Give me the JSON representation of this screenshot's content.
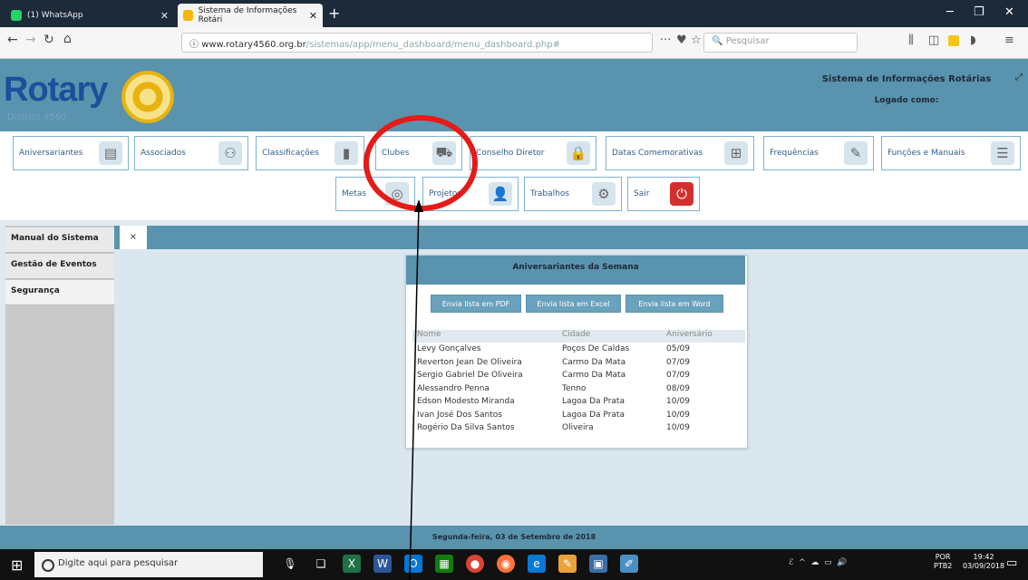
{
  "browser": {
    "tabs": [
      {
        "label": "(1) WhatsApp"
      },
      {
        "label": "Sistema de Informações Rotári"
      }
    ],
    "url": "www.rotary4560.org.br",
    "url_path": "/sistemas/app/menu_dashboard/menu_dashboard.php#",
    "search_placeholder": "Pesquisar"
  },
  "header": {
    "logo_text": "Rotary",
    "logo_sub": "Distrito 4560",
    "site_title": "Sistema de Informações Rotárias",
    "logged_as": "Logado como:"
  },
  "menu": {
    "row1": [
      {
        "label": "Aniversariantes",
        "icon": "calendar-icon"
      },
      {
        "label": "Associados",
        "icon": "people-icon"
      },
      {
        "label": "Classificações",
        "icon": "book-icon"
      },
      {
        "label": "Clubes",
        "icon": "cart-icon"
      },
      {
        "label": "Conselho Diretor",
        "icon": "lock-icon"
      },
      {
        "label": "Datas Comemorativas",
        "icon": "calendar-add-icon"
      },
      {
        "label": "Frequências",
        "icon": "tools-icon"
      },
      {
        "label": "Funções e Manuais",
        "icon": "document-icon"
      }
    ],
    "row2": [
      {
        "label": "Metas",
        "icon": "target-icon"
      },
      {
        "label": "Projetos",
        "icon": "user-icon"
      },
      {
        "label": "Trabalhos",
        "icon": "gear-icon"
      },
      {
        "label": "Sair",
        "icon": "exit-icon"
      }
    ]
  },
  "sidebar": {
    "items": [
      {
        "label": "Manual do Sistema"
      },
      {
        "label": "Gestão de Eventos"
      },
      {
        "label": "Segurança"
      }
    ]
  },
  "content_tab": {
    "close": "×"
  },
  "birthdays": {
    "title": "Aniversariantes da Semana",
    "buttons": [
      "Envia lista em PDF",
      "Envia lista em Excel",
      "Envia lista em Word"
    ],
    "columns": [
      "Nome",
      "Cidade",
      "Aniversário"
    ],
    "rows": [
      [
        "Levy Gonçalves",
        "Poços De Caldas",
        "05/09"
      ],
      [
        "Reverton Jean De Oliveira",
        "Carmo Da Mata",
        "07/09"
      ],
      [
        "Sergio Gabriel De Oliveira",
        "Carmo Da Mata",
        "07/09"
      ],
      [
        "Alessandro Penna",
        "Tenno",
        "08/09"
      ],
      [
        "Edson Modesto Miranda",
        "Lagoa Da Prata",
        "10/09"
      ],
      [
        "Ivan José Dos Santos",
        "Lagoa Da Prata",
        "10/09"
      ],
      [
        "Rogério Da Silva Santos",
        "Oliveira",
        "10/09"
      ]
    ]
  },
  "footer": {
    "date": "Segunda-feira, 03 de Setembro de 2018"
  },
  "taskbar": {
    "search_placeholder": "Digite aqui para pesquisar",
    "lang": "POR",
    "lang2": "PTB2",
    "time": "19:42",
    "date": "03/09/2018"
  },
  "annotation": {
    "color": "#e41b17"
  }
}
